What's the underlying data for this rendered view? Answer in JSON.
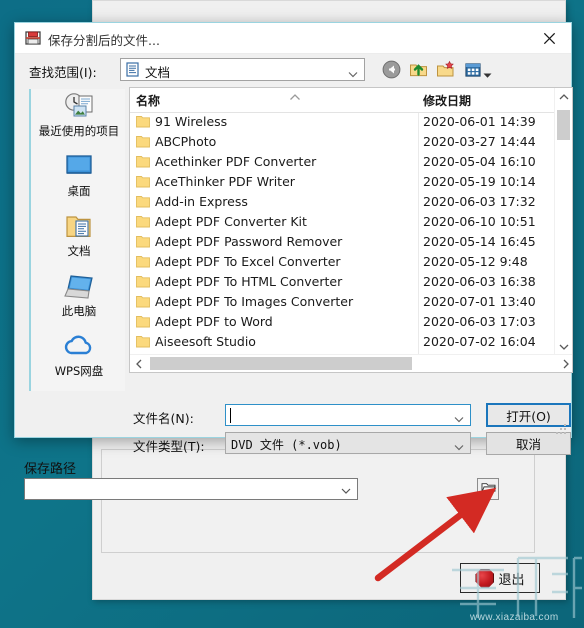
{
  "colors": {
    "desktop_teal": "#0d7089",
    "dialog_bg": "#f0f0f0",
    "dialog_border": "#9ad4e0",
    "accent_blue": "#1b76bc",
    "folder_yellow": "#fcd97f",
    "arrow_red": "#d32a23",
    "stop_red": "#c31a20"
  },
  "dialog": {
    "title": "保存分割后的文件...",
    "title_icon": "save-disk-icon",
    "close_icon": "close-icon",
    "lookin": {
      "label": "查找范围(I):",
      "value": "文档",
      "value_icon": "documents-folder-icon",
      "caret_icon": "chevron-down-icon"
    },
    "toolbar": [
      {
        "name": "back-button",
        "icon": "back-arrow-icon"
      },
      {
        "name": "up-one-level-button",
        "icon": "up-folder-icon"
      },
      {
        "name": "new-folder-button",
        "icon": "new-folder-icon"
      },
      {
        "name": "views-button",
        "icon": "views-grid-icon"
      },
      {
        "name": "views-dropdown",
        "icon": "chevron-down-icon"
      }
    ],
    "places": [
      {
        "label": "最近使用的项目",
        "icon": "recent-items-icon"
      },
      {
        "label": "桌面",
        "icon": "desktop-icon"
      },
      {
        "label": "文档",
        "icon": "documents-icon"
      },
      {
        "label": "此电脑",
        "icon": "this-pc-icon"
      },
      {
        "label": "WPS网盘",
        "icon": "wps-cloud-icon"
      }
    ],
    "listview": {
      "columns": [
        "名称",
        "修改日期"
      ],
      "sort_indicator": "ascending",
      "rows": [
        {
          "name": "91 Wireless",
          "date": "2020-06-01 14:39"
        },
        {
          "name": "ABCPhoto",
          "date": "2020-03-27 14:44"
        },
        {
          "name": "Acethinker PDF Converter",
          "date": "2020-05-04 16:10"
        },
        {
          "name": "AceThinker PDF Writer",
          "date": "2020-05-19 10:14"
        },
        {
          "name": "Add-in Express",
          "date": "2020-06-03 17:32"
        },
        {
          "name": "Adept PDF Converter Kit",
          "date": "2020-06-10 10:51"
        },
        {
          "name": "Adept PDF Password Remover",
          "date": "2020-05-14 16:45"
        },
        {
          "name": "Adept PDF To Excel Converter",
          "date": "2020-05-12 9:48"
        },
        {
          "name": "Adept PDF To HTML Converter",
          "date": "2020-06-03 16:38"
        },
        {
          "name": "Adept PDF To Images Converter",
          "date": "2020-07-01 13:40"
        },
        {
          "name": "Adept PDF to Word",
          "date": "2020-06-03 17:03"
        },
        {
          "name": "Aiseesoft Studio",
          "date": "2020-07-02 16:04"
        }
      ]
    },
    "filename": {
      "label": "文件名(N):",
      "value": "",
      "caret_icon": "chevron-down-icon"
    },
    "filetype": {
      "label": "文件类型(T):",
      "value": "DVD 文件 (*.vob)",
      "caret_icon": "chevron-down-icon"
    },
    "buttons": {
      "open": "打开(O)",
      "cancel": "取消"
    },
    "resize_grip": "resize-grip-icon"
  },
  "app": {
    "group_label": "保存路径",
    "path_value": "",
    "path_caret_icon": "chevron-down-icon",
    "browse_icon": "open-folder-icon",
    "exit_label": "退出",
    "exit_icon": "stop-octagon-icon",
    "annotation_arrow": "red-arrow-pointing-to-browse-button"
  },
  "watermark": {
    "text": "下载吧",
    "url": "www.xiazaiba.com"
  }
}
